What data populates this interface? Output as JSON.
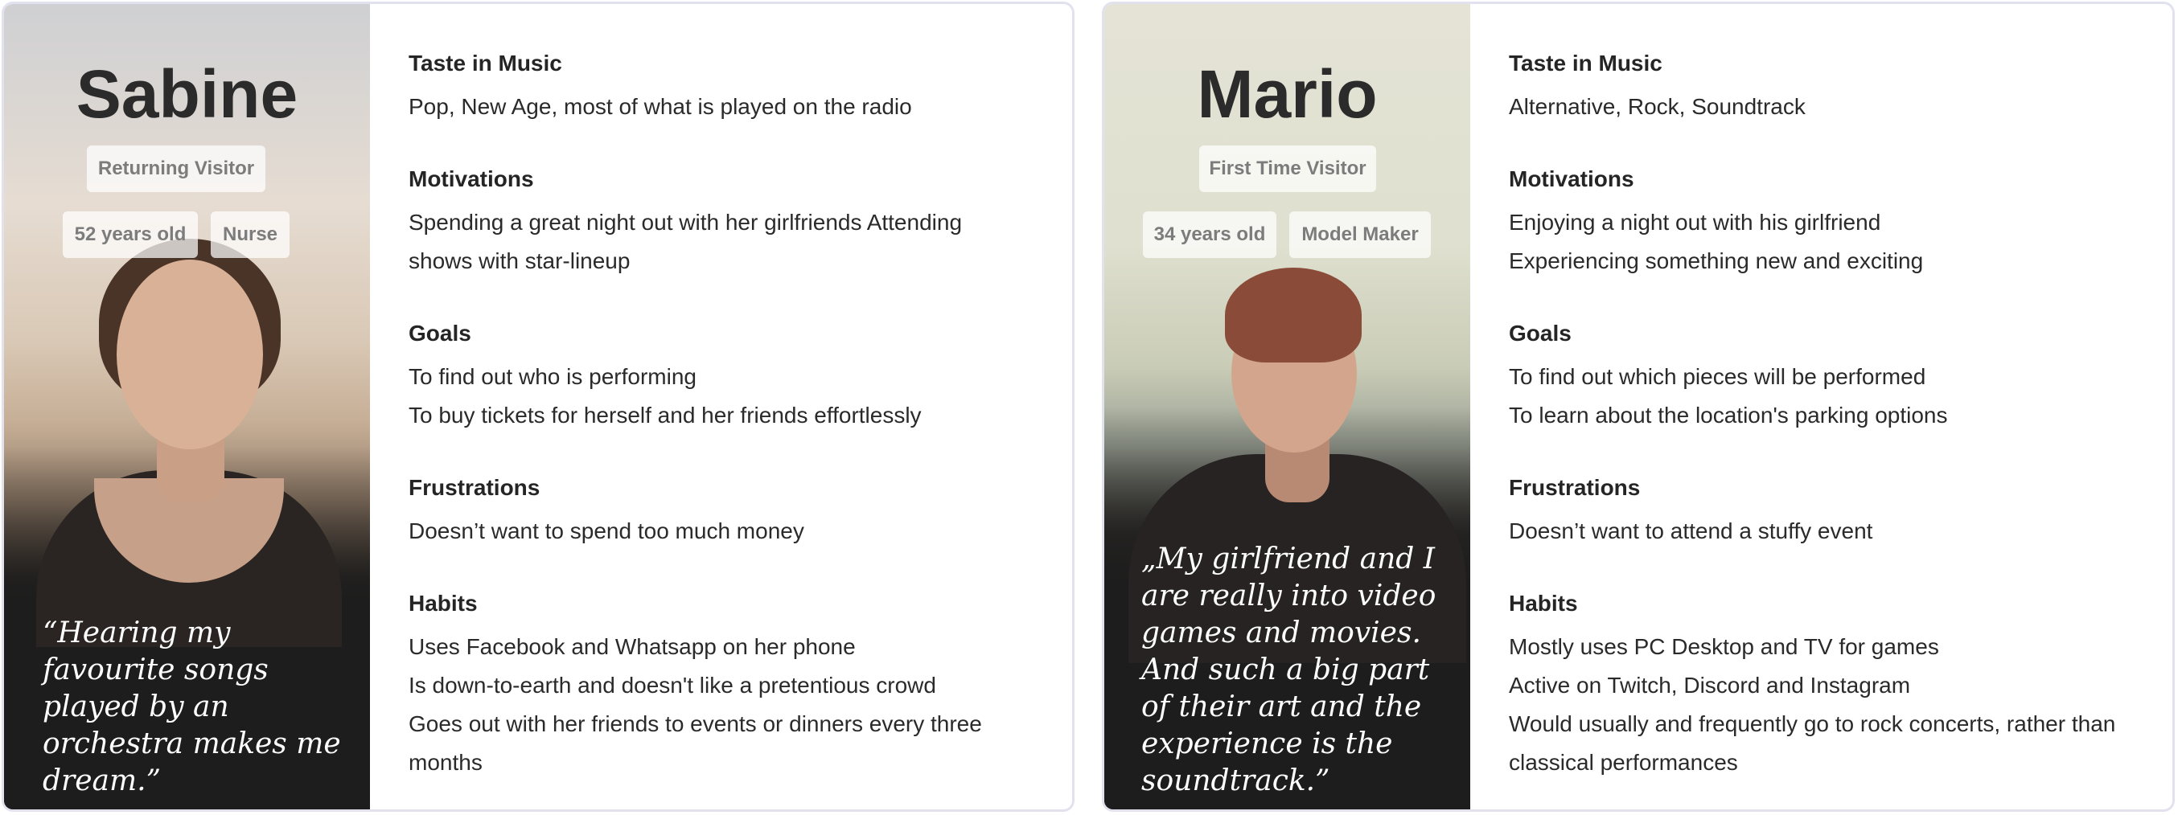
{
  "personas": [
    {
      "name": "Sabine",
      "visitor_type": "Returning Visitor",
      "age": "52 years old",
      "occupation": "Nurse",
      "quote": "“Hearing my favourite songs played by an orchestra makes me dream.”",
      "taste": {
        "title": "Taste in Music",
        "lines": [
          "Pop, New Age, most of what is played on the radio"
        ]
      },
      "motivations": {
        "title": "Motivations",
        "lines": [
          "Spending a great night out with her girlfriends Attending",
          "shows with star-lineup"
        ]
      },
      "goals": {
        "title": "Goals",
        "lines": [
          "To find out who is performing",
          "To buy tickets for herself and her friends effortlessly"
        ]
      },
      "frustrations": {
        "title": "Frustrations",
        "lines": [
          "Doesn’t want to spend too much money"
        ]
      },
      "habits": {
        "title": "Habits",
        "lines": [
          "Uses Facebook and Whatsapp on her phone",
          "Is down-to-earth and doesn't like a pretentious crowd",
          "Goes out with her friends to events or dinners every three",
          "months"
        ]
      }
    },
    {
      "name": "Mario",
      "visitor_type": "First Time Visitor",
      "age": "34 years old",
      "occupation": "Model Maker",
      "quote": "„My girlfriend and I are really into video games and movies. And such a big part of their art and the experience is the soundtrack.”",
      "taste": {
        "title": "Taste in Music",
        "lines": [
          "Alternative, Rock, Soundtrack"
        ]
      },
      "motivations": {
        "title": "Motivations",
        "lines": [
          "Enjoying a night out with his girlfriend",
          "Experiencing something new and exciting"
        ]
      },
      "goals": {
        "title": "Goals",
        "lines": [
          "To find out which pieces will be performed",
          "To learn about the location's parking options"
        ]
      },
      "frustrations": {
        "title": "Frustrations",
        "lines": [
          "Doesn’t want to attend a stuffy event"
        ]
      },
      "habits": {
        "title": "Habits",
        "lines": [
          "Mostly uses PC Desktop and TV for games",
          "Active on Twitch, Discord and Instagram",
          "Would usually and frequently go to rock concerts, rather than",
          "classical performances"
        ]
      }
    }
  ]
}
